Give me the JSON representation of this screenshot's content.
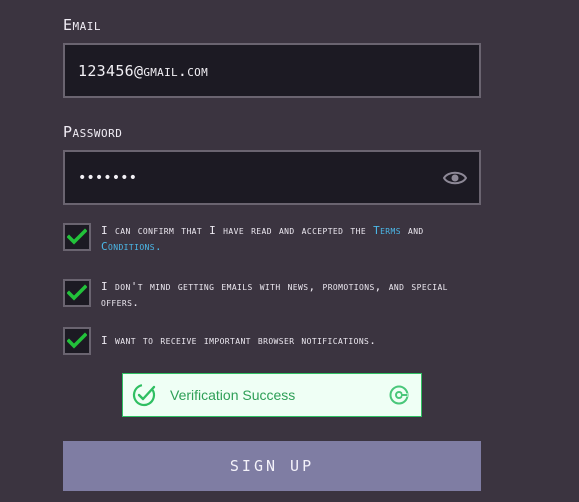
{
  "email": {
    "label": "Email",
    "value": "123456@gmail.com"
  },
  "password": {
    "label": "Password",
    "value": "•••••••",
    "toggle_icon": "eye-icon"
  },
  "checkboxes": [
    {
      "checked": true,
      "text_before": "I can confirm that I have read and accepted the ",
      "link1": "Terms",
      "text_middle": " and ",
      "link2": "Conditions",
      "text_after": "."
    },
    {
      "checked": true,
      "text": "I don't mind getting emails with news, promotions, and special offers."
    },
    {
      "checked": true,
      "text": "I want to receive important browser notifications."
    }
  ],
  "verification": {
    "status_text": "Verification Success",
    "status_icon": "check-circle-icon",
    "brand_icon": "captcha-logo-icon",
    "color": "#2e9f57"
  },
  "signup_button": {
    "label": "SIGN UP"
  },
  "colors": {
    "background": "#3b3440",
    "field_bg": "#1c1a23",
    "field_border": "#6a6470",
    "link": "#4bb8e8",
    "check": "#22c23a",
    "button": "#7f7da3"
  }
}
